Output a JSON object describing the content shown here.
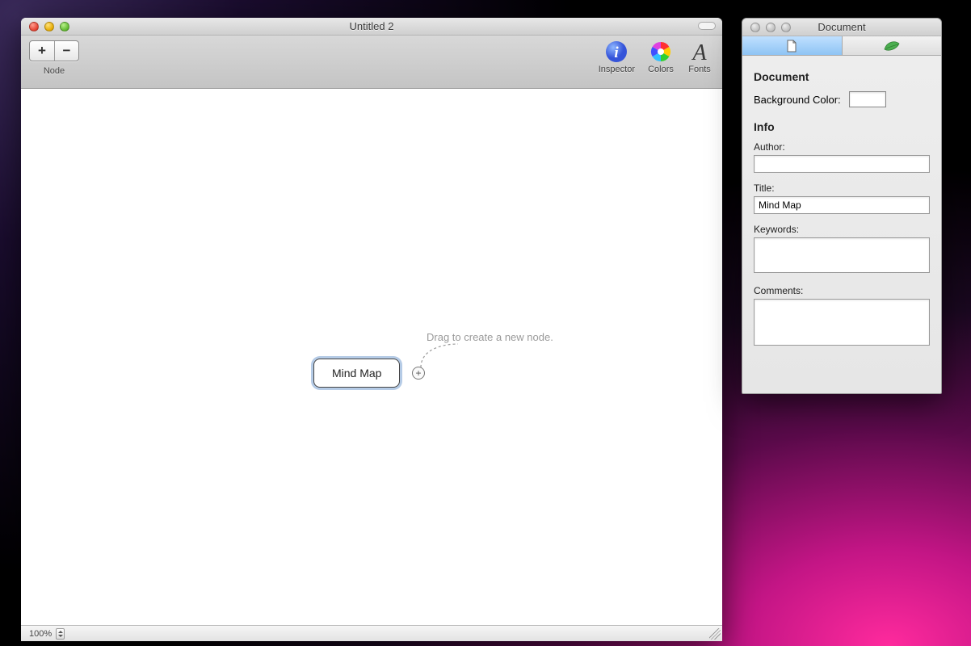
{
  "main_window": {
    "title": "Untitled 2",
    "toolbar": {
      "node_group_label": "Node",
      "add_label": "+",
      "remove_label": "−",
      "inspector_label": "Inspector",
      "colors_label": "Colors",
      "fonts_label": "Fonts"
    },
    "canvas": {
      "root_node_text": "Mind Map",
      "hint_text": "Drag to create a new node."
    },
    "statusbar": {
      "zoom": "100%"
    }
  },
  "inspector": {
    "title": "Document",
    "tabs": {
      "document_icon": "document-icon",
      "node_icon": "leaf-icon"
    },
    "document_section": {
      "heading": "Document",
      "bg_label": "Background Color:",
      "bg_value": "#ffffff"
    },
    "info_section": {
      "heading": "Info",
      "author_label": "Author:",
      "author_value": "",
      "title_label": "Title:",
      "title_value": "Mind Map",
      "keywords_label": "Keywords:",
      "keywords_value": "",
      "comments_label": "Comments:",
      "comments_value": ""
    }
  }
}
